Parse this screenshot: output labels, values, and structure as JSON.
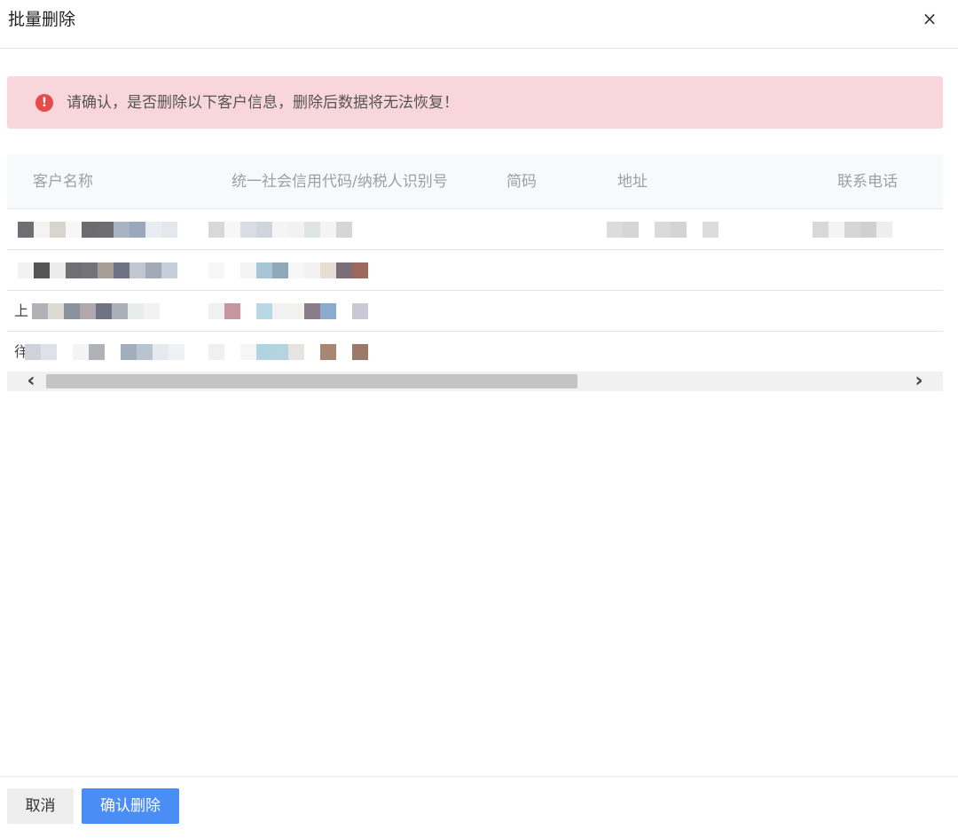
{
  "dialog": {
    "title": "批量删除",
    "close_icon": "×"
  },
  "alert": {
    "icon": "!",
    "icon_name": "error-exclamation-icon",
    "text": "请确认，是否删除以下客户信息，删除后数据将无法恢复！",
    "background_color": "#f9d6db",
    "icon_color": "#e44b4b"
  },
  "table": {
    "columns": [
      "客户名称",
      "统一社会信用代码/纳税人识别号",
      "简码",
      "地址",
      "联系电话"
    ],
    "rows": [
      {
        "name_prefix": ""
      },
      {
        "name_prefix": ""
      },
      {
        "name_prefix": "上"
      },
      {
        "name_prefix": "徉"
      }
    ]
  },
  "scrollbar": {
    "left_icon": "‹",
    "right_icon": "›"
  },
  "footer": {
    "cancel_label": "取消",
    "confirm_label": "确认删除",
    "confirm_color": "#4a8df5"
  }
}
